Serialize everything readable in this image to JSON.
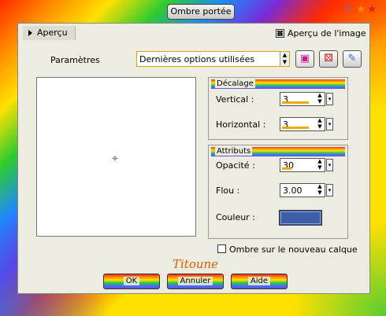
{
  "window": {
    "title": "Ombre portée"
  },
  "preview_bar": {
    "tab_label": "Aperçu",
    "image_preview_label": "Aperçu de l'image",
    "image_preview_checked": true
  },
  "params": {
    "label": "Paramètres",
    "preset_value": "Dernières options utilisées"
  },
  "offset": {
    "header": "Décalage",
    "vertical_label": "Vertical :",
    "vertical_value": "3",
    "horizontal_label": "Horizontal :",
    "horizontal_value": "3"
  },
  "attributes": {
    "header": "Attributs",
    "opacity_label": "Opacité :",
    "opacity_value": "30",
    "blur_label": "Flou :",
    "blur_value": "3.00",
    "color_label": "Couleur :",
    "color_hex": "#3d5ea8"
  },
  "new_layer": {
    "label": "Ombre sur le nouveau calque",
    "checked": false
  },
  "buttons": {
    "ok": "OK",
    "cancel": "Annuler",
    "help": "Aide"
  },
  "signature": "Titoune"
}
